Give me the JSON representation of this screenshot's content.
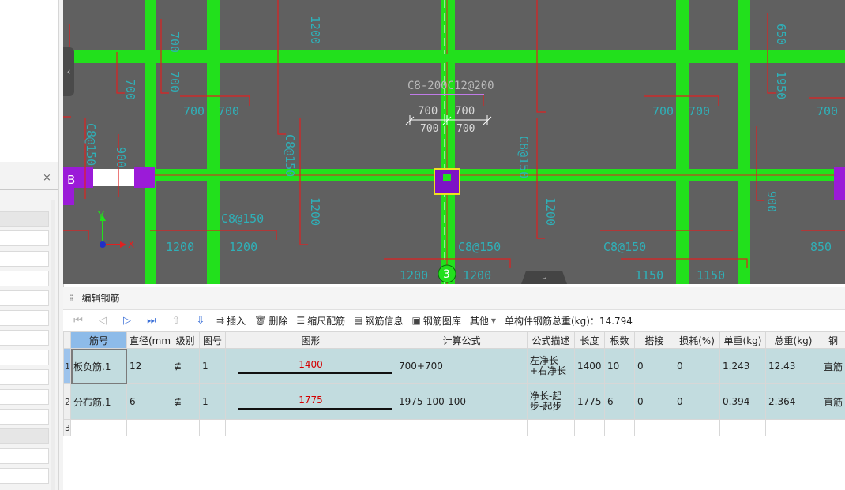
{
  "left_panel": {
    "close_label": "×"
  },
  "cad": {
    "rebar_label": "C8-200C12@200",
    "dim_700_a": "700",
    "dim_700_b": "700",
    "dim_700_c": "700",
    "dim_700_d": "700",
    "axis_b": "B",
    "axis_3": "3",
    "axis_y": "Y",
    "axis_x": "X",
    "labels": {
      "t1200a": "1200",
      "t1200b": "1200",
      "t1200c": "1200",
      "t1200d": "1200",
      "t1150a": "1150",
      "t1150b": "1150",
      "t700a": "700",
      "t700b": "700",
      "t700c": "700",
      "t700d": "700",
      "t700e": "700",
      "t850": "850",
      "c8a": "C8@150",
      "c8b": "C8@150",
      "c8c": "C8@150",
      "v1200a": "1200",
      "v1200b": "1200",
      "v1200c": "1200",
      "v700a": "700",
      "v700b": "700",
      "v700c": "700",
      "v900a": "900",
      "v900b": "900",
      "vc1": "C8@150",
      "vc2": "C8@150",
      "vc3": "C8@150",
      "v650": "650",
      "v1950": "1950"
    }
  },
  "editor": {
    "title": "编辑钢筋",
    "toolbar": {
      "insert": "插入",
      "delete": "删除",
      "scale": "缩尺配筋",
      "info": "钢筋信息",
      "library": "钢筋图库",
      "other": "其他",
      "total": "单构件钢筋总重(kg)：14.794"
    },
    "columns": [
      "筋号",
      "直径(mm)",
      "级别",
      "图号",
      "图形",
      "计算公式",
      "公式描述",
      "长度",
      "根数",
      "搭接",
      "损耗(%)",
      "单重(kg)",
      "总重(kg)",
      "钢"
    ],
    "rows": [
      {
        "num": "1",
        "name": "板负筋.1",
        "dia": "12",
        "grade": "⊈",
        "fig": "1",
        "shape_len": "1400",
        "formula": "700+700",
        "desc": "左净长+右净长",
        "len": "1400",
        "count": "10",
        "lap": "0",
        "loss": "0",
        "unit": "1.243",
        "total": "12.43",
        "type": "直筋"
      },
      {
        "num": "2",
        "name": "分布筋.1",
        "dia": "6",
        "grade": "⊈",
        "fig": "1",
        "shape_len": "1775",
        "formula": "1975-100-100",
        "desc": "净长-起步-起步",
        "len": "1775",
        "count": "6",
        "lap": "0",
        "loss": "0",
        "unit": "0.394",
        "total": "2.364",
        "type": "直筋"
      },
      {
        "num": "3"
      }
    ]
  }
}
